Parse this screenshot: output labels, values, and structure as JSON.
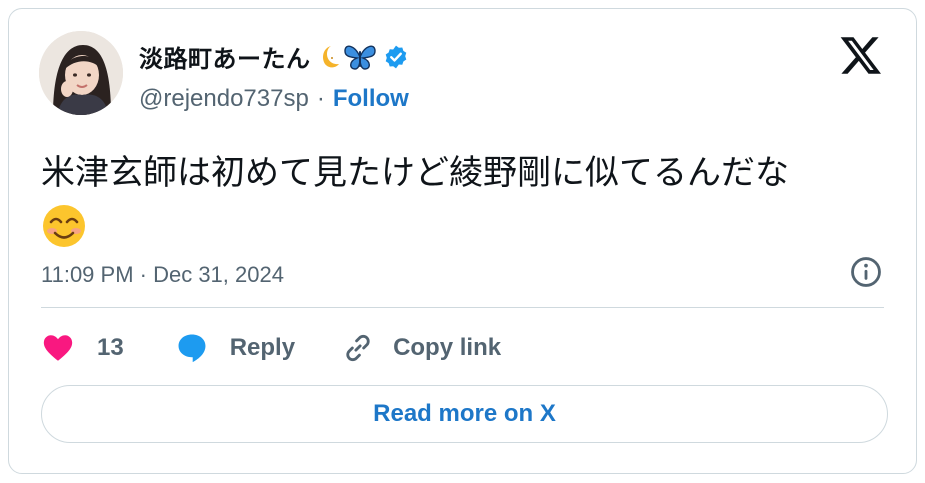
{
  "author": {
    "display_name": "淡路町あーたん",
    "handle": "@rejendo737sp",
    "follow_label": "Follow",
    "verified": true,
    "name_emojis": [
      "crescent-moon",
      "butterfly"
    ]
  },
  "tweet": {
    "text": "米津玄師は初めて見たけど綾野剛に似てるんだな",
    "trailing_emoji": "smiling-face-with-smiling-eyes",
    "timestamp": "11:09 PM · Dec 31, 2024"
  },
  "actions": {
    "like_count": "13",
    "reply_label": "Reply",
    "copy_label": "Copy link"
  },
  "cta": {
    "read_more_label": "Read more on X"
  },
  "colors": {
    "like": "#f91880",
    "reply": "#1d9bf0",
    "link_blue": "#1d77c8",
    "muted": "#536471",
    "text": "#0f1419",
    "border": "#cfd9de"
  }
}
